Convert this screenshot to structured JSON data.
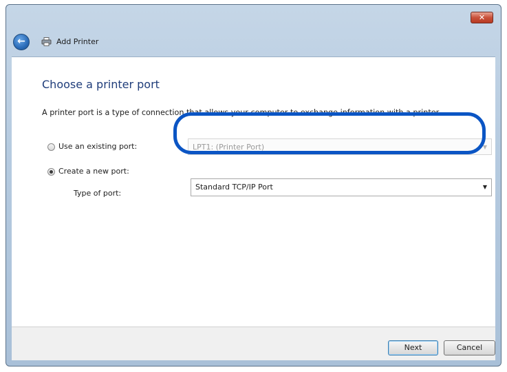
{
  "window": {
    "title": "Add Printer",
    "close_glyph": "✕",
    "back_glyph": "←"
  },
  "page": {
    "heading": "Choose a printer port",
    "description": "A printer port is a type of connection that allows your computer to exchange information with a printer."
  },
  "existing_port": {
    "label": "Use an existing port:",
    "selected": false,
    "value": "LPT1: (Printer Port)"
  },
  "new_port": {
    "label": "Create a new port:",
    "selected": true,
    "type_label": "Type of port:",
    "value": "Standard TCP/IP Port"
  },
  "buttons": {
    "next": "Next",
    "cancel": "Cancel"
  },
  "colors": {
    "highlight": "#0b55c4",
    "heading": "#1f3d7a"
  },
  "icons": {
    "back": "back-arrow-icon",
    "printer": "printer-icon",
    "close": "close-icon",
    "dropdown": "chevron-down-icon"
  }
}
